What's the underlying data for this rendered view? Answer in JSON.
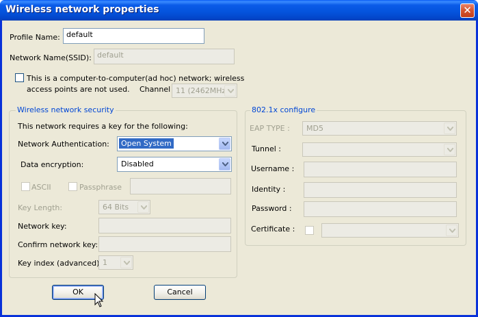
{
  "window": {
    "title": "Wireless network properties",
    "close_symbol": "✕"
  },
  "profile": {
    "label": "Profile Name:",
    "value": "default"
  },
  "ssid": {
    "label": "Network Name(SSID):",
    "value": "default"
  },
  "adhoc": {
    "line1": "This is a computer-to-computer(ad hoc) network; wireless",
    "line2": "access points are not used.",
    "channel_label": "Channel",
    "channel_value": "11 (2462MHz)"
  },
  "security": {
    "group_title": "Wireless network security",
    "requires_text": "This network requires a key for the following:",
    "auth_label": "Network Authentication:",
    "auth_value": "Open System",
    "encryption_label": "Data encryption:",
    "encryption_value": "Disabled",
    "ascii_label": "ASCII",
    "passphrase_label": "Passphrase",
    "key_length_label": "Key Length:",
    "key_length_value": "64 Bits",
    "network_key_label": "Network key:",
    "confirm_key_label": "Confirm network key:",
    "key_index_label": "Key index (advanced):",
    "key_index_value": "1"
  },
  "dot1x": {
    "group_title": "802.1x configure",
    "eap_label": "EAP TYPE :",
    "eap_value": "MD5",
    "tunnel_label": "Tunnel :",
    "username_label": "Username :",
    "identity_label": "Identity :",
    "password_label": "Password :",
    "certificate_label": "Certificate :"
  },
  "buttons": {
    "ok": "OK",
    "cancel": "Cancel"
  }
}
